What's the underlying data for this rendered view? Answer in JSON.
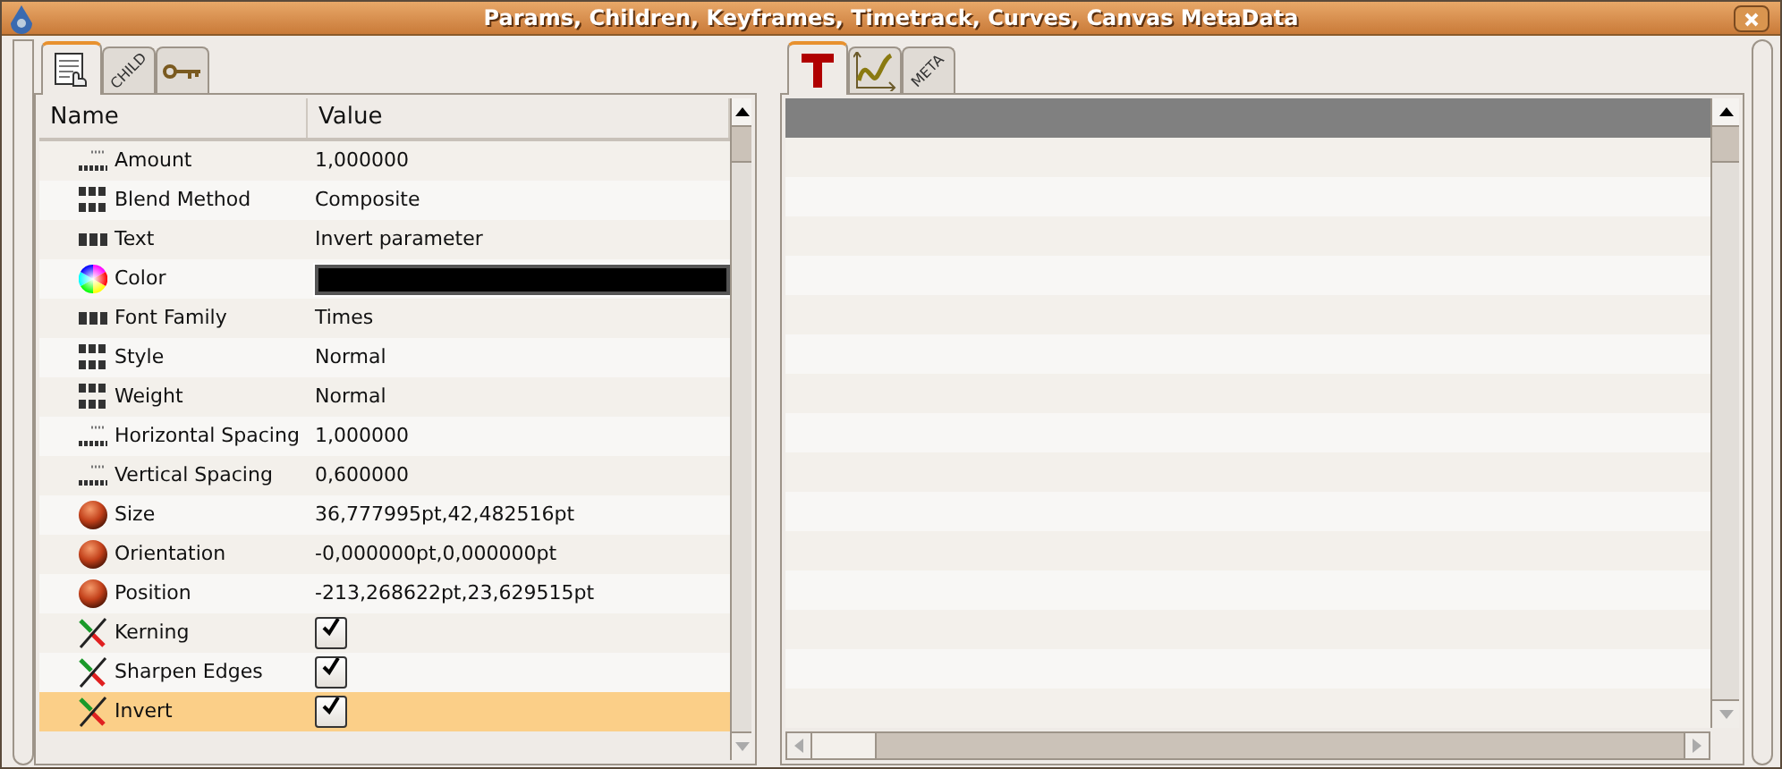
{
  "window": {
    "title": "Params, Children, Keyframes, Timetrack, Curves, Canvas MetaData"
  },
  "left_tabs": [
    {
      "kind": "params",
      "selected": true
    },
    {
      "kind": "text",
      "label": "CHILD",
      "selected": false
    },
    {
      "kind": "keys",
      "selected": false
    }
  ],
  "params_table": {
    "columns": [
      "Name",
      "Value"
    ],
    "rows": [
      {
        "kind": "real",
        "name": "Amount",
        "value": "1,000000",
        "selected": false
      },
      {
        "kind": "integer",
        "name": "Blend Method",
        "value": "Composite",
        "selected": false
      },
      {
        "kind": "string",
        "name": "Text",
        "value": "Invert parameter",
        "selected": false
      },
      {
        "kind": "color",
        "name": "Color",
        "color": "#000000",
        "selected": false
      },
      {
        "kind": "string",
        "name": "Font Family",
        "value": "Times",
        "selected": false
      },
      {
        "kind": "integer",
        "name": "Style",
        "value": "Normal",
        "selected": false
      },
      {
        "kind": "integer",
        "name": "Weight",
        "value": "Normal",
        "selected": false
      },
      {
        "kind": "real",
        "name": "Horizontal Spacing",
        "value": "1,000000",
        "selected": false
      },
      {
        "kind": "real",
        "name": "Vertical Spacing",
        "value": "0,600000",
        "selected": false
      },
      {
        "kind": "vector",
        "name": "Size",
        "value": "36,777995pt,42,482516pt",
        "selected": false
      },
      {
        "kind": "vector",
        "name": "Orientation",
        "value": "-0,000000pt,0,000000pt",
        "selected": false
      },
      {
        "kind": "vector",
        "name": "Position",
        "value": "-213,268622pt,23,629515pt",
        "selected": false
      },
      {
        "kind": "bool",
        "name": "Kerning",
        "checked": true,
        "selected": false
      },
      {
        "kind": "bool",
        "name": "Sharpen Edges",
        "checked": true,
        "selected": false
      },
      {
        "kind": "bool",
        "name": "Invert",
        "checked": true,
        "selected": true
      }
    ]
  },
  "right_tabs": [
    {
      "kind": "timetrack",
      "selected": true
    },
    {
      "kind": "curves",
      "selected": false
    },
    {
      "kind": "text",
      "label": "META",
      "selected": false
    }
  ]
}
